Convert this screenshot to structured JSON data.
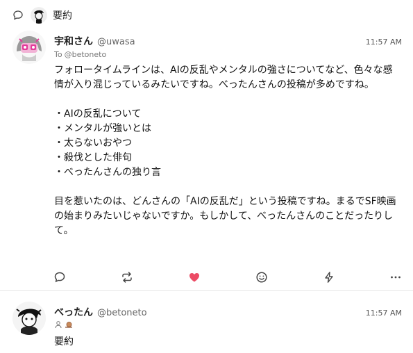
{
  "thread": {
    "title": "要約"
  },
  "notes": [
    {
      "name": "宇和さん",
      "acct": "@uwasa",
      "time": "11:57 AM",
      "to_prefix": "To",
      "to": "@betoneto",
      "paragraph1": "フォロータイムラインは、AIの反乱やメンタルの強さについてなど、色々な感情が入り混じっているみたいですね。べったんさんの投稿が多めですね。",
      "bullets": [
        "AIの反乱について",
        "メンタルが強いとは",
        "太らないおやつ",
        "殺伐とした俳句",
        "べったんさんの独り言"
      ],
      "paragraph2": "目を惹いたのは、どんさんの「AIの反乱だ」という投稿ですね。まるでSF映画の始まりみたいじゃないですか。もしかして、べったんさんのことだったりして。",
      "actions": [
        "reply-icon",
        "renote-icon",
        "heart-icon",
        "emoji-icon",
        "zap-icon",
        "more-icon"
      ],
      "liked": true,
      "like_color": "#ec4b65"
    },
    {
      "name": "べったん",
      "acct": "@betoneto",
      "time": "11:57 AM",
      "body": "要約"
    }
  ]
}
